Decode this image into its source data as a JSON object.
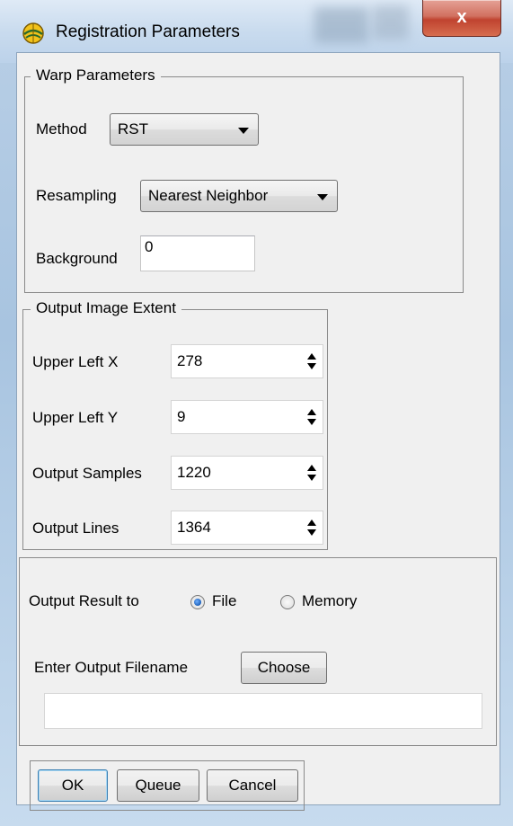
{
  "window": {
    "title": "Registration Parameters",
    "close_label": "x",
    "icon": "idl-globe-icon"
  },
  "warp": {
    "legend": "Warp Parameters",
    "method_label": "Method",
    "method_value": "RST",
    "resampling_label": "Resampling",
    "resampling_value": "Nearest Neighbor",
    "background_label": "Background",
    "background_value": "0"
  },
  "extent": {
    "legend": "Output Image Extent",
    "fields": [
      {
        "label": "Upper Left X",
        "value": "278"
      },
      {
        "label": "Upper Left Y",
        "value": "9"
      },
      {
        "label": "Output Samples",
        "value": "1220"
      },
      {
        "label": "Output Lines",
        "value": "1364"
      }
    ]
  },
  "output": {
    "result_to_label": "Output Result to",
    "option_file": "File",
    "option_memory": "Memory",
    "selected": "File",
    "filename_label": "Enter Output Filename",
    "choose_label": "Choose",
    "filename_value": ""
  },
  "actions": {
    "ok": "OK",
    "queue": "Queue",
    "cancel": "Cancel"
  }
}
